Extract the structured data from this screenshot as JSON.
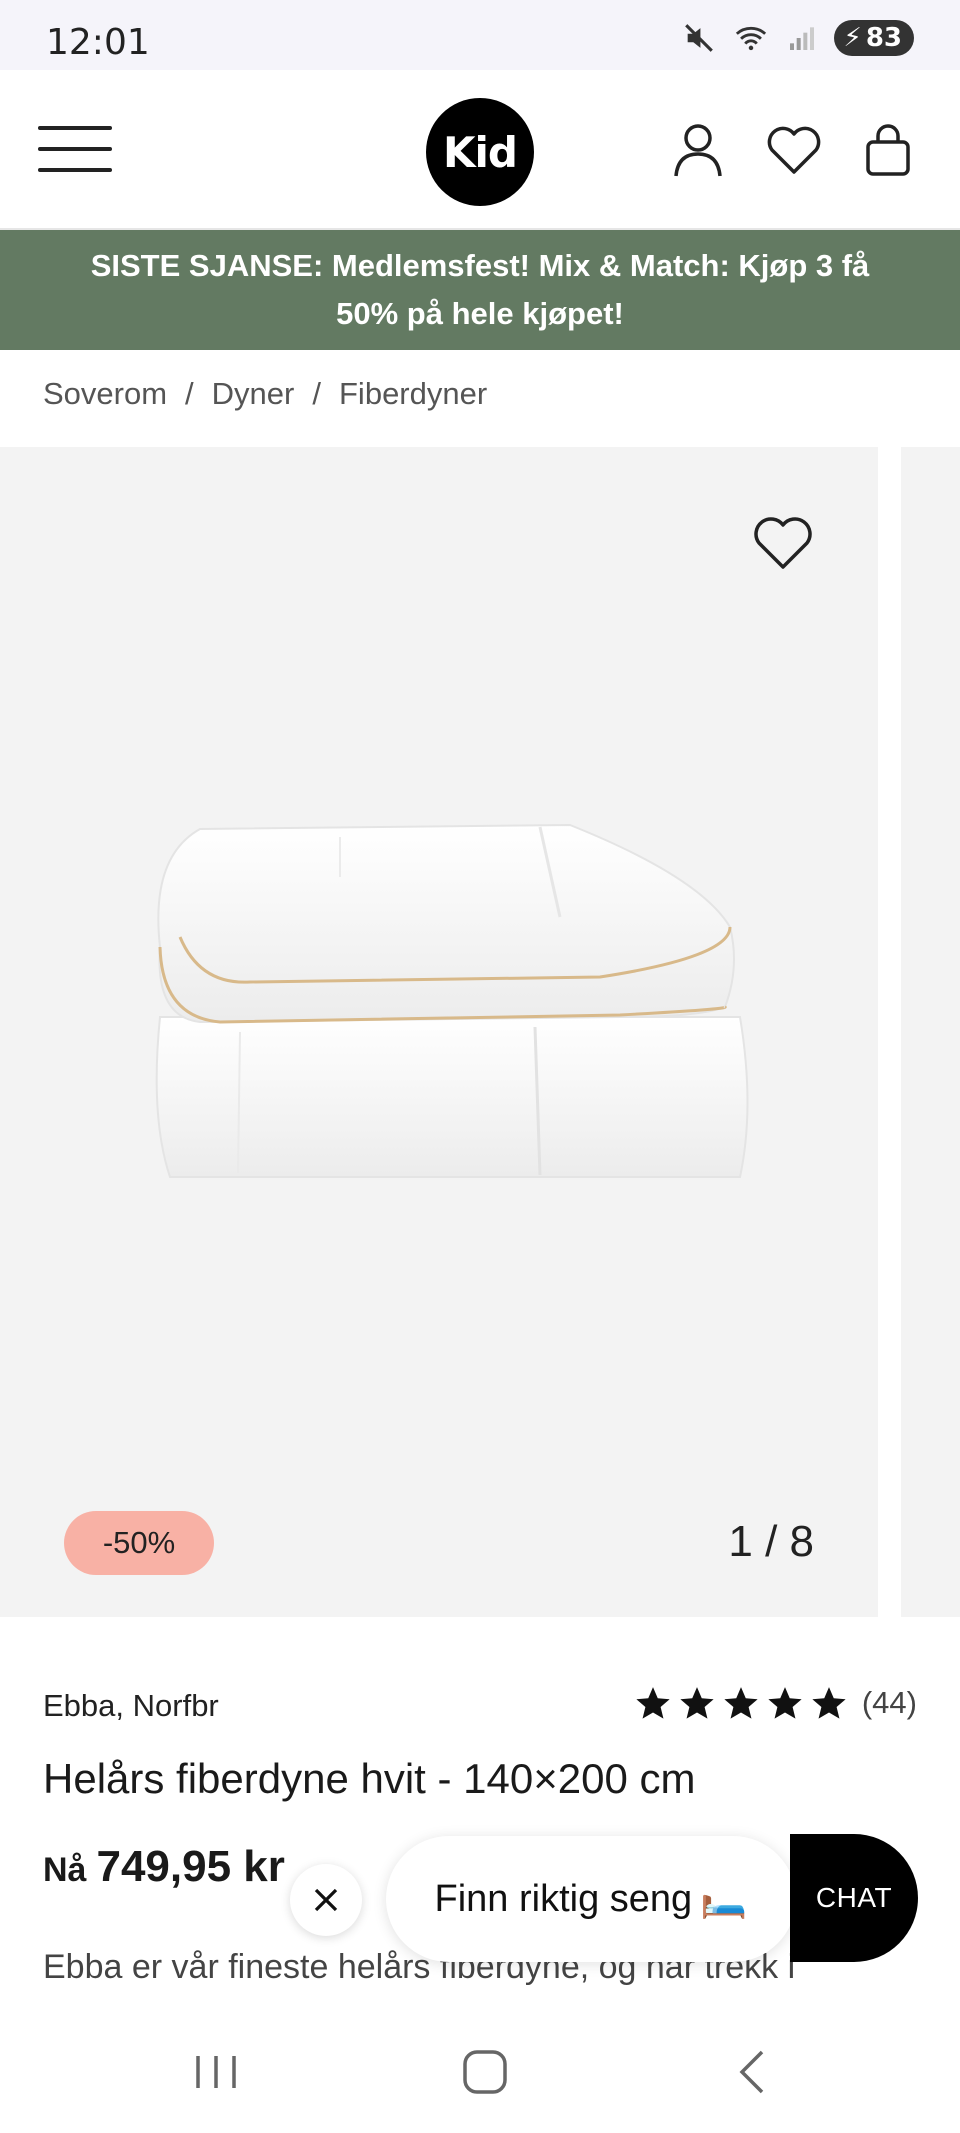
{
  "status_bar": {
    "time": "12:01",
    "battery": "83",
    "icons": [
      "mute-icon",
      "wifi-icon",
      "signal-icon",
      "battery-icon"
    ]
  },
  "header": {
    "logo": "Kid",
    "icons": [
      "menu-icon",
      "user-icon",
      "heart-icon",
      "bag-icon"
    ]
  },
  "promo": {
    "text": "SISTE SJANSE: Medlemsfest! Mix & Match: Kjøp 3 få 50% på hele kjøpet!",
    "background": "#637a62"
  },
  "breadcrumb": {
    "items": [
      "Soverom",
      "Dyner",
      "Fiberdyner"
    ],
    "separator": "/"
  },
  "gallery": {
    "discount_badge": "-50%",
    "counter": "1 / 8",
    "badge_color": "#f8b1a5"
  },
  "product": {
    "brand": "Ebba, Norfbr",
    "rating_stars": 5,
    "review_count": "(44)",
    "title": "Helårs fiberdyne hvit - 140×200 cm",
    "price_prefix": "Nå",
    "price": "749,95 kr",
    "old_price": "",
    "description": "Ebba er vår fineste helårs fiberdyne, og har trekk i"
  },
  "chat": {
    "prompt": "Finn riktig seng",
    "prompt_emoji": "🛏️",
    "button": "CHAT"
  },
  "navbar": {
    "icons": [
      "recent-apps-icon",
      "home-icon",
      "back-icon"
    ]
  }
}
